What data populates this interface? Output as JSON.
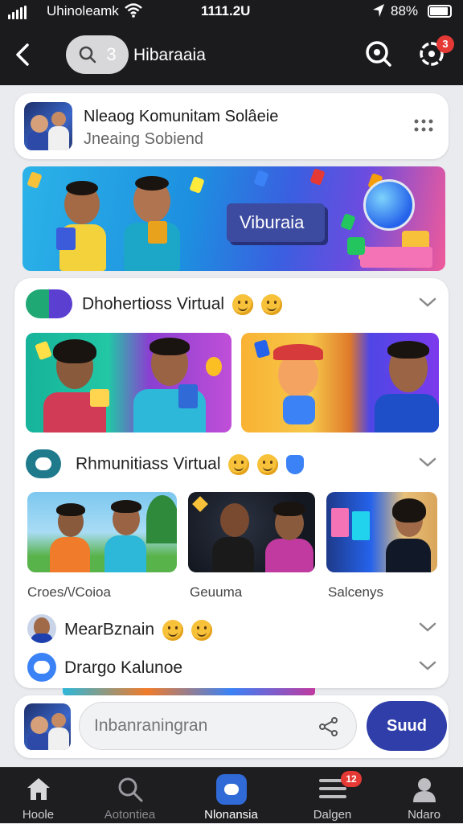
{
  "status_bar": {
    "carrier": "Uhinoleamk",
    "time": "1111.2U",
    "battery": "88%"
  },
  "top_bar": {
    "search_count": "3",
    "title": "Hibaraaia",
    "notifications": "3"
  },
  "community": {
    "name": "Nleaog Komunitam Solâeie",
    "subtitle": "Jneaing Sobiend"
  },
  "banner": {
    "label": "Viburaia"
  },
  "sections": [
    {
      "title": "Dhohertioss Virtual"
    },
    {
      "title": "Rhmunitiass Virtual"
    }
  ],
  "thumbnails": [
    {
      "label": "Croes/\\/Coioa"
    },
    {
      "label": "Geuuma"
    },
    {
      "label": "Salcenys"
    }
  ],
  "list_rows": [
    {
      "title": "MearBznain"
    },
    {
      "title": "Drargo Kalunoe"
    }
  ],
  "composer": {
    "placeholder": "Inbanraningran",
    "send_label": "Suud"
  },
  "tabs": [
    {
      "label": "Hoole",
      "icon": "home-icon"
    },
    {
      "label": "Aotontiea",
      "icon": "search-icon"
    },
    {
      "label": "Nlonansia",
      "icon": "community-icon"
    },
    {
      "label": "Dalgen",
      "icon": "list-icon",
      "badge": "12"
    },
    {
      "label": "Ndaro",
      "icon": "profile-icon"
    }
  ],
  "colors": {
    "accent": "#2f3ea8",
    "badge": "#e53935",
    "bar": "#1b1b1d"
  }
}
